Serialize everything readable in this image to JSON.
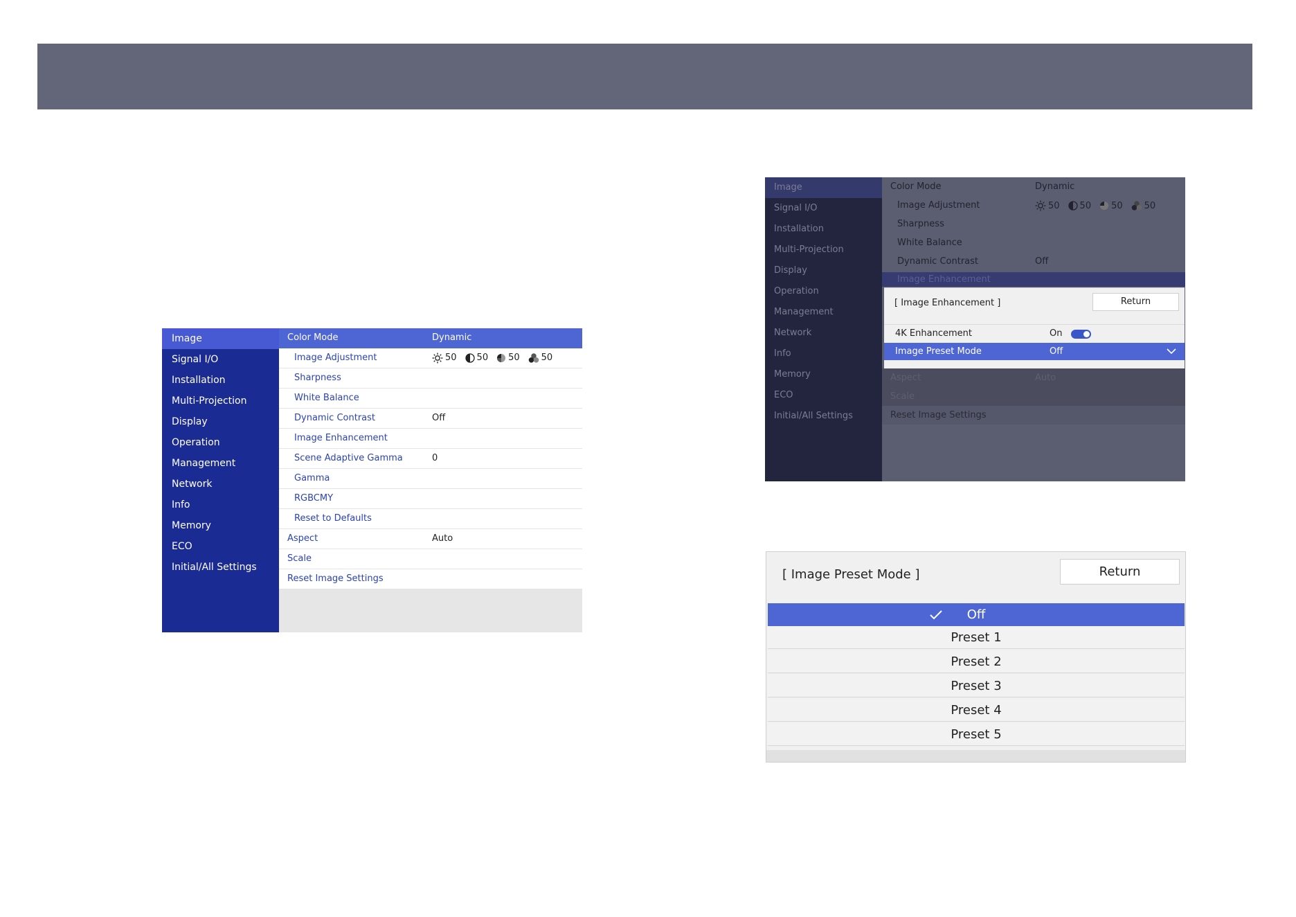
{
  "menu1": {
    "sidebar": [
      "Image",
      "Signal I/O",
      "Installation",
      "Multi-Projection",
      "Display",
      "Operation",
      "Management",
      "Network",
      "Info",
      "Memory",
      "ECO",
      "Initial/All Settings"
    ],
    "rows": [
      {
        "label": "Color Mode",
        "value": "Dynamic"
      },
      {
        "label": "Image Adjustment",
        "value": ""
      },
      {
        "label": "Sharpness",
        "value": ""
      },
      {
        "label": "White Balance",
        "value": ""
      },
      {
        "label": "Dynamic Contrast",
        "value": "Off"
      },
      {
        "label": "Image Enhancement",
        "value": ""
      },
      {
        "label": "Scene Adaptive Gamma",
        "value": "0"
      },
      {
        "label": "Gamma",
        "value": ""
      },
      {
        "label": "RGBCMY",
        "value": ""
      },
      {
        "label": "Reset to Defaults",
        "value": ""
      },
      {
        "label": "Aspect",
        "value": "Auto"
      },
      {
        "label": "Scale",
        "value": ""
      },
      {
        "label": "Reset Image Settings",
        "value": ""
      }
    ],
    "adjust_values": [
      "50",
      "50",
      "50",
      "50"
    ]
  },
  "menu2": {
    "sidebar": [
      "Image",
      "Signal I/O",
      "Installation",
      "Multi-Projection",
      "Display",
      "Operation",
      "Management",
      "Network",
      "Info",
      "Memory",
      "ECO",
      "Initial/All Settings"
    ],
    "rows": [
      {
        "label": "Color Mode",
        "value": "Dynamic"
      },
      {
        "label": "Image Adjustment",
        "value": ""
      },
      {
        "label": "Sharpness",
        "value": ""
      },
      {
        "label": "White Balance",
        "value": ""
      },
      {
        "label": "Dynamic Contrast",
        "value": "Off"
      },
      {
        "label": "Image Enhancement",
        "value": ""
      },
      {
        "label": "Aspect",
        "value": "Auto"
      },
      {
        "label": "Scale",
        "value": ""
      },
      {
        "label": "Reset Image Settings",
        "value": ""
      }
    ],
    "adjust_values": [
      "50",
      "50",
      "50",
      "50"
    ],
    "popup": {
      "title": "[ Image Enhancement ]",
      "return_label": "Return",
      "row1_label": "4K Enhancement",
      "row1_value": "On",
      "row2_label": "Image Preset Mode",
      "row2_value": "Off"
    }
  },
  "menu3": {
    "title": "[ Image Preset Mode ]",
    "return_label": "Return",
    "options": [
      "Off",
      "Preset 1",
      "Preset 2",
      "Preset 3",
      "Preset 4",
      "Preset 5"
    ]
  },
  "colors": {
    "header": "#636679",
    "sidebar": "#1b2b94",
    "selection": "#4e66d4"
  }
}
